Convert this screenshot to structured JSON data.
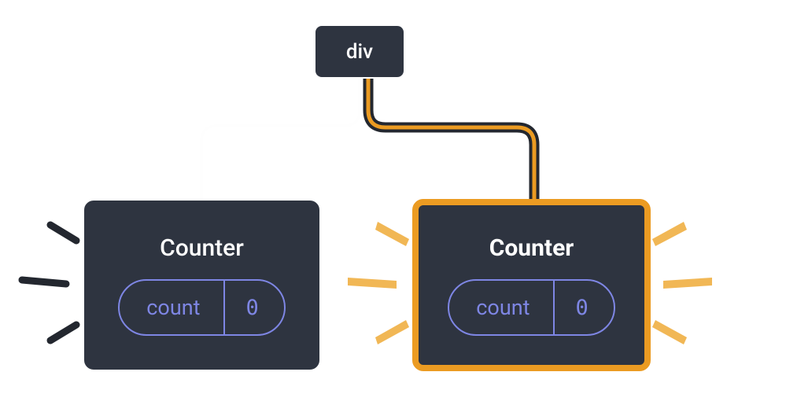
{
  "root": {
    "label": "div"
  },
  "children": [
    {
      "title": "Counter",
      "state_key": "count",
      "state_value": "0",
      "highlighted": false
    },
    {
      "title": "Counter",
      "state_key": "count",
      "state_value": "0",
      "highlighted": true
    }
  ],
  "colors": {
    "node_bg": "#2e3440",
    "node_border": "#fefefe",
    "highlight": "#eb9b22",
    "state": "#7e86e4",
    "spark_dark": "#23272f",
    "spark_gold": "#f1b755"
  }
}
